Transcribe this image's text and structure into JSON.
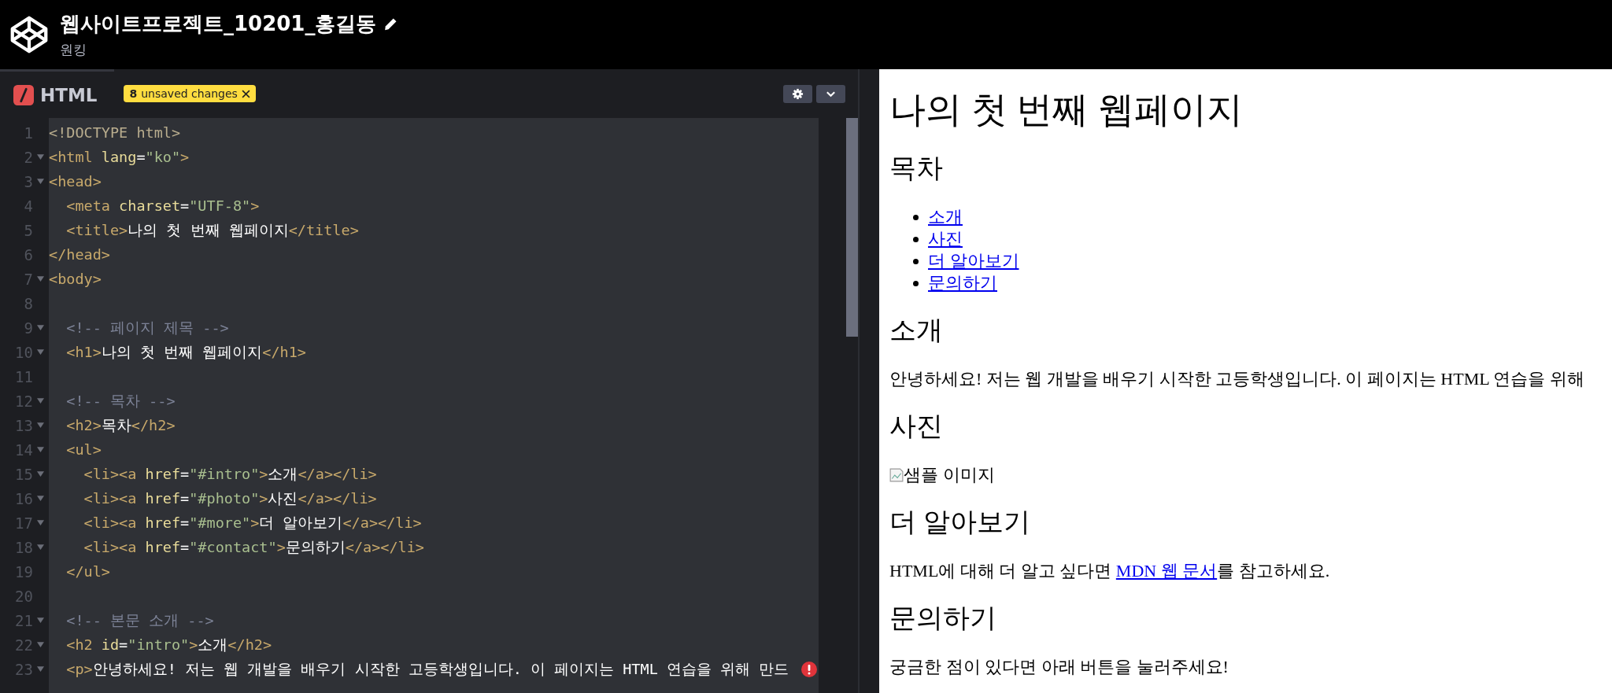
{
  "header": {
    "title": "웹사이트프로젝트_10201_홍길동",
    "subtitle": "원킹"
  },
  "editor": {
    "tab": {
      "label": "HTML",
      "selected": true
    },
    "badge": {
      "count": "8",
      "text": "unsaved changes"
    },
    "lines": [
      {
        "number": "1",
        "fold": false,
        "tokens": [
          {
            "kind": "doctype",
            "text": "<!DOCTYPE html>"
          }
        ]
      },
      {
        "number": "2",
        "fold": true,
        "tokens": [
          {
            "kind": "tag",
            "text": "<html "
          },
          {
            "kind": "attr",
            "text": "lang"
          },
          {
            "kind": "plain",
            "text": "="
          },
          {
            "kind": "string",
            "text": "\"ko\""
          },
          {
            "kind": "tag",
            "text": ">"
          }
        ]
      },
      {
        "number": "3",
        "fold": true,
        "tokens": [
          {
            "kind": "tag",
            "text": "<head>"
          }
        ]
      },
      {
        "number": "4",
        "fold": false,
        "tokens": [
          {
            "kind": "tag",
            "text": "  <meta "
          },
          {
            "kind": "attr",
            "text": "charset"
          },
          {
            "kind": "plain",
            "text": "="
          },
          {
            "kind": "string",
            "text": "\"UTF-8\""
          },
          {
            "kind": "tag",
            "text": ">"
          }
        ]
      },
      {
        "number": "5",
        "fold": false,
        "tokens": [
          {
            "kind": "tag",
            "text": "  <title>"
          },
          {
            "kind": "plain",
            "text": "나의 첫 번째 웹페이지"
          },
          {
            "kind": "tag",
            "text": "</title>"
          }
        ]
      },
      {
        "number": "6",
        "fold": false,
        "tokens": [
          {
            "kind": "tag",
            "text": "</head>"
          }
        ]
      },
      {
        "number": "7",
        "fold": true,
        "tokens": [
          {
            "kind": "tag",
            "text": "<body>"
          }
        ]
      },
      {
        "number": "8",
        "fold": false
      },
      {
        "number": "9",
        "fold": true,
        "tokens": [
          {
            "kind": "comment",
            "text": "  <!-- 페이지 제목 -->"
          }
        ]
      },
      {
        "number": "10",
        "fold": true,
        "tokens": [
          {
            "kind": "tag",
            "text": "  <h1>"
          },
          {
            "kind": "plain",
            "text": "나의 첫 번째 웹페이지"
          },
          {
            "kind": "tag",
            "text": "</h1>"
          }
        ]
      },
      {
        "number": "11",
        "fold": false
      },
      {
        "number": "12",
        "fold": true,
        "tokens": [
          {
            "kind": "comment",
            "text": "  <!-- 목차 -->"
          }
        ]
      },
      {
        "number": "13",
        "fold": true,
        "tokens": [
          {
            "kind": "tag",
            "text": "  <h2>"
          },
          {
            "kind": "plain",
            "text": "목차"
          },
          {
            "kind": "tag",
            "text": "</h2>"
          }
        ]
      },
      {
        "number": "14",
        "fold": true,
        "tokens": [
          {
            "kind": "tag",
            "text": "  <ul>"
          }
        ]
      },
      {
        "number": "15",
        "fold": true,
        "tokens": [
          {
            "kind": "tag",
            "text": "    <li><a "
          },
          {
            "kind": "attr",
            "text": "href"
          },
          {
            "kind": "plain",
            "text": "="
          },
          {
            "kind": "string",
            "text": "\"#intro\""
          },
          {
            "kind": "tag",
            "text": ">"
          },
          {
            "kind": "plain",
            "text": "소개"
          },
          {
            "kind": "tag",
            "text": "</a></li>"
          }
        ]
      },
      {
        "number": "16",
        "fold": true,
        "tokens": [
          {
            "kind": "tag",
            "text": "    <li><a "
          },
          {
            "kind": "attr",
            "text": "href"
          },
          {
            "kind": "plain",
            "text": "="
          },
          {
            "kind": "string",
            "text": "\"#photo\""
          },
          {
            "kind": "tag",
            "text": ">"
          },
          {
            "kind": "plain",
            "text": "사진"
          },
          {
            "kind": "tag",
            "text": "</a></li>"
          }
        ]
      },
      {
        "number": "17",
        "fold": true,
        "tokens": [
          {
            "kind": "tag",
            "text": "    <li><a "
          },
          {
            "kind": "attr",
            "text": "href"
          },
          {
            "kind": "plain",
            "text": "="
          },
          {
            "kind": "string",
            "text": "\"#more\""
          },
          {
            "kind": "tag",
            "text": ">"
          },
          {
            "kind": "plain",
            "text": "더 알아보기"
          },
          {
            "kind": "tag",
            "text": "</a></li>"
          }
        ]
      },
      {
        "number": "18",
        "fold": true,
        "tokens": [
          {
            "kind": "tag",
            "text": "    <li><a "
          },
          {
            "kind": "attr",
            "text": "href"
          },
          {
            "kind": "plain",
            "text": "="
          },
          {
            "kind": "string",
            "text": "\"#contact\""
          },
          {
            "kind": "tag",
            "text": ">"
          },
          {
            "kind": "plain",
            "text": "문의하기"
          },
          {
            "kind": "tag",
            "text": "</a></li>"
          }
        ]
      },
      {
        "number": "19",
        "fold": false,
        "tokens": [
          {
            "kind": "tag",
            "text": "  </ul>"
          }
        ]
      },
      {
        "number": "20",
        "fold": false
      },
      {
        "number": "21",
        "fold": true,
        "tokens": [
          {
            "kind": "comment",
            "text": "  <!-- 본문 소개 -->"
          }
        ]
      },
      {
        "number": "22",
        "fold": true,
        "tokens": [
          {
            "kind": "tag",
            "text": "  <h2 "
          },
          {
            "kind": "attr",
            "text": "id"
          },
          {
            "kind": "plain",
            "text": "="
          },
          {
            "kind": "string",
            "text": "\"intro\""
          },
          {
            "kind": "tag",
            "text": ">"
          },
          {
            "kind": "plain",
            "text": "소개"
          },
          {
            "kind": "tag",
            "text": "</h2>"
          }
        ]
      },
      {
        "number": "23",
        "fold": true,
        "error": true,
        "tokens": [
          {
            "kind": "tag",
            "text": "  <p>"
          },
          {
            "kind": "plain",
            "text": "안녕하세요! 저는 웹 개발을 배우기 시작한 고등학생입니다. 이 페이지는 HTML 연습을 위해 만드"
          }
        ]
      }
    ]
  },
  "preview": {
    "blocks": [
      {
        "kind": "h1",
        "text": "나의 첫 번째 웹페이지"
      },
      {
        "kind": "h2",
        "text": "목차"
      },
      {
        "kind": "list",
        "items": [
          "소개",
          "사진",
          "더 알아보기",
          "문의하기"
        ]
      },
      {
        "kind": "h2",
        "text": "소개"
      },
      {
        "kind": "p",
        "text": "안녕하세요! 저는 웹 개발을 배우기 시작한 고등학생입니다. 이 페이지는 HTML 연습을 위해"
      },
      {
        "kind": "h2",
        "text": "사진"
      },
      {
        "kind": "image",
        "alt": "샘플 이미지"
      },
      {
        "kind": "h2",
        "text": "더 알아보기"
      },
      {
        "kind": "link_p",
        "before": "HTML에 대해 더 알고 싶다면 ",
        "link": "MDN 웹 문서",
        "after": "를 참고하세요."
      },
      {
        "kind": "h2",
        "text": "문의하기"
      },
      {
        "kind": "p",
        "text": "궁금한 점이 있다면 아래 버튼을 눌러주세요!"
      }
    ]
  }
}
